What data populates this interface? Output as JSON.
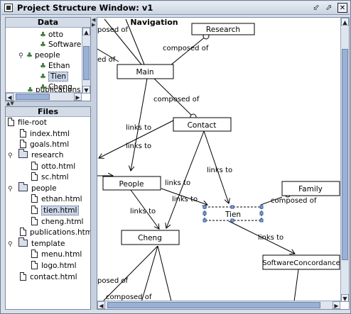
{
  "window": {
    "title": "Project Structure Window: v1"
  },
  "data_panel": {
    "header": "Data",
    "items": [
      {
        "label": "otto",
        "icon": "person-icon"
      },
      {
        "label": "Software C",
        "icon": "person-icon"
      },
      {
        "label": "people",
        "icon": "person-icon"
      },
      {
        "label": "Ethan",
        "icon": "person-icon"
      },
      {
        "label": "Tien",
        "icon": "person-icon"
      },
      {
        "label": "Cheng",
        "icon": "person-icon"
      },
      {
        "label": "publications",
        "icon": "person-icon"
      }
    ]
  },
  "files_panel": {
    "header": "Files",
    "items": [
      {
        "label": "file-root",
        "icon": "file-icon"
      },
      {
        "label": "index.html",
        "icon": "file-icon"
      },
      {
        "label": "goals.html",
        "icon": "file-icon"
      },
      {
        "label": "research",
        "icon": "folder-icon"
      },
      {
        "label": "otto.html",
        "icon": "file-icon"
      },
      {
        "label": "sc.html",
        "icon": "file-icon"
      },
      {
        "label": "people",
        "icon": "folder-icon"
      },
      {
        "label": "ethan.html",
        "icon": "file-icon"
      },
      {
        "label": "tien.html",
        "icon": "file-icon"
      },
      {
        "label": "cheng.html",
        "icon": "file-icon"
      },
      {
        "label": "publications.html",
        "icon": "file-icon"
      },
      {
        "label": "template",
        "icon": "folder-icon"
      },
      {
        "label": "menu.html",
        "icon": "file-icon"
      },
      {
        "label": "logo.html",
        "icon": "file-icon"
      },
      {
        "label": "contact.html",
        "icon": "file-icon"
      }
    ]
  },
  "navigation": {
    "header": "Navigation",
    "nodes": {
      "research": "Research",
      "main": "Main",
      "contact": "Contact",
      "people": "People",
      "family": "Family",
      "tien": "Tien",
      "cheng": "Cheng",
      "software_concordance": "SoftwareConcordance"
    },
    "edge_labels": {
      "composed_of_top_left": "posed of",
      "composed_of_left": "ed of",
      "composed_of_main": "composed of",
      "composed_of_contact": "composed of",
      "links_to_1": "links to",
      "links_to_2": "links to",
      "links_to_contact": "links to",
      "links_to_people_tien": "links to",
      "links_to_people_tien_2": "links to",
      "links_to_people_cheng": "links to",
      "composed_of_family": "composed of",
      "links_to_tien_sc": "links to",
      "composed_of_bottom_left": "posed of",
      "composed_of_bottom": "composed of"
    }
  }
}
